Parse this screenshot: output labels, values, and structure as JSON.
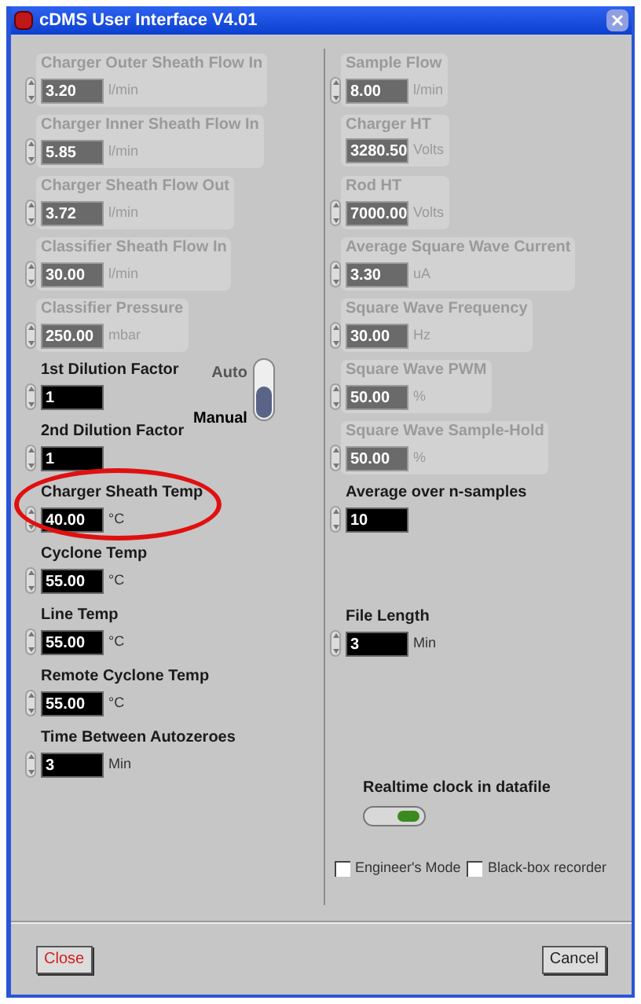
{
  "window": {
    "title": "cDMS User Interface V4.01"
  },
  "left_fields": [
    {
      "label": "Charger Outer Sheath Flow In",
      "value": "3.20",
      "unit": "l/min",
      "disabled": true,
      "spinner": true
    },
    {
      "label": "Charger Inner Sheath Flow In",
      "value": "5.85",
      "unit": "l/min",
      "disabled": true,
      "spinner": true
    },
    {
      "label": "Charger Sheath Flow Out",
      "value": "3.72",
      "unit": "l/min",
      "disabled": true,
      "spinner": true
    },
    {
      "label": "Classifier Sheath Flow In",
      "value": "30.00",
      "unit": "l/min",
      "disabled": true,
      "spinner": true
    },
    {
      "label": "Classifier Pressure",
      "value": "250.00",
      "unit": "mbar",
      "disabled": true,
      "spinner": true
    },
    {
      "label": "1st Dilution Factor",
      "value": "1",
      "disabled": false,
      "spinner": true
    },
    {
      "label": "2nd Dilution Factor",
      "value": "1",
      "disabled": false,
      "spinner": true
    },
    {
      "label": "Charger Sheath Temp",
      "value": "40.00",
      "unit": "°C",
      "disabled": false,
      "spinner": true,
      "highlighted": true
    },
    {
      "label": "Cyclone Temp",
      "value": "55.00",
      "unit": "°C",
      "disabled": false,
      "spinner": true
    },
    {
      "label": "Line Temp",
      "value": "55.00",
      "unit": "°C",
      "disabled": false,
      "spinner": true
    },
    {
      "label": "Remote Cyclone Temp",
      "value": "55.00",
      "unit": "°C",
      "disabled": false,
      "spinner": true
    },
    {
      "label": "Time Between Autozeroes",
      "value": "3",
      "unit": "Min",
      "disabled": false,
      "spinner": true
    }
  ],
  "dilution_switch": {
    "options": [
      {
        "label": "Auto",
        "selected": false
      },
      {
        "label": "Manual",
        "selected": true
      }
    ]
  },
  "right_fields": [
    {
      "label": "Sample Flow",
      "value": "8.00",
      "unit": "l/min",
      "disabled": true,
      "spinner": true
    },
    {
      "label": "Charger HT",
      "value": "3280.50",
      "unit": "Volts",
      "disabled": true,
      "spinner": false
    },
    {
      "label": "Rod HT",
      "value": "7000.00",
      "unit": "Volts",
      "disabled": true,
      "spinner": true
    },
    {
      "label": "Average Square Wave Current",
      "value": "3.30",
      "unit": "uA",
      "disabled": true,
      "spinner": true
    },
    {
      "label": "Square Wave Frequency",
      "value": "30.00",
      "unit": "Hz",
      "disabled": true,
      "spinner": true
    },
    {
      "label": "Square Wave PWM",
      "value": "50.00",
      "unit": "%",
      "disabled": true,
      "spinner": true
    },
    {
      "label": "Square Wave Sample-Hold",
      "value": "50.00",
      "unit": "%",
      "disabled": true,
      "spinner": true
    },
    {
      "label": "Average over n-samples",
      "value": "10",
      "disabled": false,
      "spinner": true
    }
  ],
  "file_length": {
    "label": "File Length",
    "value": "3",
    "unit": "Min",
    "disabled": false,
    "spinner": true
  },
  "realtime_clock": {
    "label": "Realtime clock in datafile",
    "on": true
  },
  "checkboxes": [
    {
      "label": "Engineer's Mode",
      "checked": false
    },
    {
      "label": "Black-box recorder",
      "checked": false
    }
  ],
  "buttons": [
    {
      "label": "Close",
      "kind": "close"
    },
    {
      "label": "Cancel",
      "kind": "cancel"
    }
  ]
}
